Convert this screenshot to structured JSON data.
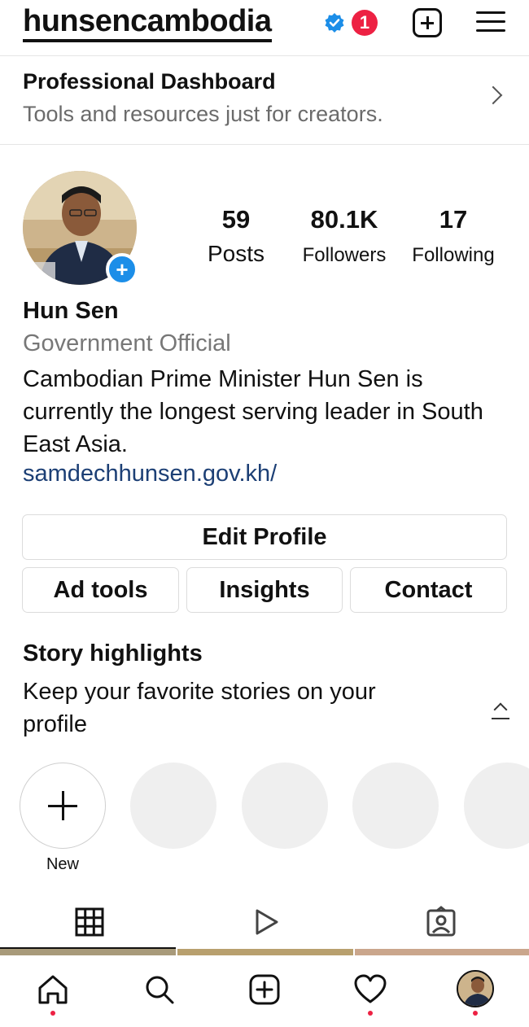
{
  "header": {
    "username": "hunsencambodia",
    "notification_count": "1",
    "icons": [
      "verified-badge-icon",
      "new-post-icon",
      "menu-icon"
    ]
  },
  "dashboard": {
    "title": "Professional Dashboard",
    "subtitle": "Tools and resources just for creators."
  },
  "profile": {
    "stats": [
      {
        "value": "59",
        "label": "Posts"
      },
      {
        "value": "80.1K",
        "label": "Followers"
      },
      {
        "value": "17",
        "label": "Following"
      }
    ],
    "name": "Hun Sen",
    "category": "Government Official",
    "bio": "Cambodian Prime Minister Hun Sen is currently the longest serving leader in South East Asia.",
    "link": "samdechhunsen.gov.kh/",
    "avatar_add": "+"
  },
  "buttons": {
    "edit_profile": "Edit Profile",
    "ad_tools": "Ad tools",
    "insights": "Insights",
    "contact": "Contact"
  },
  "highlights": {
    "title": "Story highlights",
    "subtitle": "Keep your favorite stories on your profile",
    "new_label": "New"
  },
  "tabs": [
    "grid-icon",
    "reels-icon",
    "tagged-icon"
  ],
  "bottom_nav": [
    "home-icon",
    "search-icon",
    "create-icon",
    "heart-icon",
    "profile-avatar"
  ],
  "colors": {
    "accent_blue": "#1c8ee8",
    "link": "#1c3f75",
    "badge_red": "#ed2143",
    "muted_text": "#6b6b6b"
  }
}
